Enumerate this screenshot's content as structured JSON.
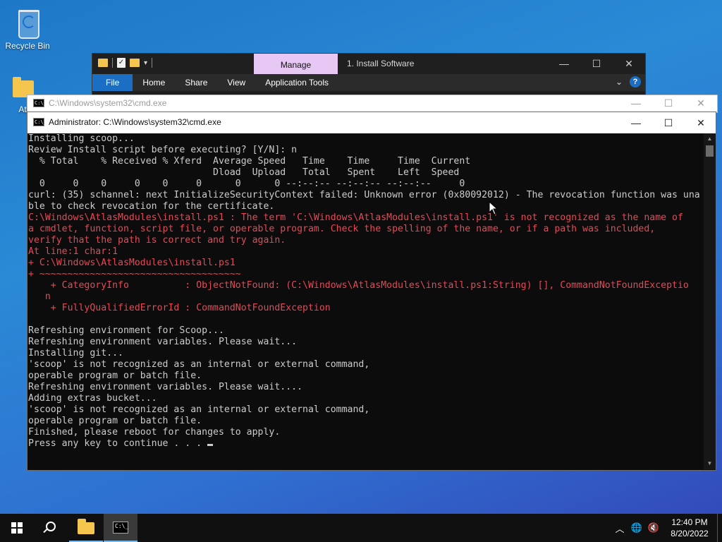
{
  "desktop": {
    "icons": [
      {
        "label": "Recycle Bin"
      },
      {
        "label": "At"
      }
    ]
  },
  "explorer": {
    "manage_tab": "Manage",
    "title": "1. Install Software",
    "ribbon": [
      "File",
      "Home",
      "Share",
      "View",
      "Application Tools"
    ],
    "help": "?"
  },
  "cmd_back": {
    "title": "C:\\Windows\\system32\\cmd.exe"
  },
  "cmd": {
    "title": "Administrator: C:\\Windows\\system32\\cmd.exe",
    "icon_text": "C:\\_",
    "lines": [
      {
        "text": "Installing scoop...",
        "type": "normal"
      },
      {
        "text": "Review Install script before executing? [Y/N]: n",
        "type": "normal"
      },
      {
        "text": "  % Total    % Received % Xferd  Average Speed   Time    Time     Time  Current",
        "type": "normal"
      },
      {
        "text": "                                 Dload  Upload   Total   Spent    Left  Speed",
        "type": "normal"
      },
      {
        "text": "  0     0    0     0    0     0      0      0 --:--:-- --:--:-- --:--:--     0",
        "type": "normal"
      },
      {
        "text": "curl: (35) schannel: next InitializeSecurityContext failed: Unknown error (0x80092012) - The revocation function was una",
        "type": "normal"
      },
      {
        "text": "ble to check revocation for the certificate.",
        "type": "normal"
      },
      {
        "text": "C:\\Windows\\AtlasModules\\install.ps1 : The term 'C:\\Windows\\AtlasModules\\install.ps1' is not recognized as the name of",
        "type": "error"
      },
      {
        "text": "a cmdlet, function, script file, or operable program. Check the spelling of the name, or if a path was included,",
        "type": "error"
      },
      {
        "text": "verify that the path is correct and try again.",
        "type": "error"
      },
      {
        "text": "At line:1 char:1",
        "type": "error"
      },
      {
        "text": "+ C:\\Windows\\AtlasModules\\install.ps1",
        "type": "error"
      },
      {
        "text": "+ ~~~~~~~~~~~~~~~~~~~~~~~~~~~~~~~~~~~~",
        "type": "error"
      },
      {
        "text": "    + CategoryInfo          : ObjectNotFound: (C:\\Windows\\AtlasModules\\install.ps1:String) [], CommandNotFoundExceptio",
        "type": "error"
      },
      {
        "text": "   n",
        "type": "error"
      },
      {
        "text": "    + FullyQualifiedErrorId : CommandNotFoundException",
        "type": "error"
      },
      {
        "text": "",
        "type": "normal"
      },
      {
        "text": "Refreshing environment for Scoop...",
        "type": "normal"
      },
      {
        "text": "Refreshing environment variables. Please wait...",
        "type": "normal"
      },
      {
        "text": "Installing git...",
        "type": "normal"
      },
      {
        "text": "'scoop' is not recognized as an internal or external command,",
        "type": "normal"
      },
      {
        "text": "operable program or batch file.",
        "type": "normal"
      },
      {
        "text": "Refreshing environment variables. Please wait....",
        "type": "normal"
      },
      {
        "text": "Adding extras bucket...",
        "type": "normal"
      },
      {
        "text": "'scoop' is not recognized as an internal or external command,",
        "type": "normal"
      },
      {
        "text": "operable program or batch file.",
        "type": "normal"
      },
      {
        "text": "Finished, please reboot for changes to apply.",
        "type": "normal"
      },
      {
        "text": "Press any key to continue . . . ",
        "type": "prompt"
      }
    ]
  },
  "taskbar": {
    "time": "12:40 PM",
    "date": "8/20/2022",
    "tray_icons": [
      "chevron-up-icon",
      "globe-icon",
      "volume-muted-icon"
    ]
  },
  "colors": {
    "error": "#e74856",
    "console_text": "#cccccc",
    "console_bg": "#0c0c0c",
    "manage_tab": "#e7c8f4",
    "file_tab": "#1a6fc4"
  }
}
